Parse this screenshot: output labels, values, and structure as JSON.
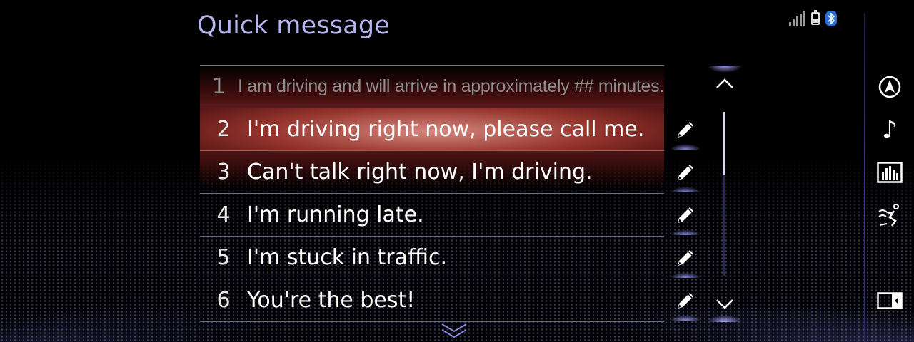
{
  "header": {
    "title": "Quick message"
  },
  "status": {
    "signal_icon": "signal-bars-icon",
    "battery_icon": "battery-icon",
    "bluetooth_icon": "bluetooth-icon",
    "bluetooth_color": "#2a6fd6"
  },
  "messages": [
    {
      "num": "1",
      "text": "I am driving and will arrive in approximately ## minutes."
    },
    {
      "num": "2",
      "text": "I'm driving right now, please call me."
    },
    {
      "num": "3",
      "text": "Can't talk right now, I'm driving."
    },
    {
      "num": "4",
      "text": "I'm running late."
    },
    {
      "num": "5",
      "text": "I'm stuck in traffic."
    },
    {
      "num": "6",
      "text": "You're the best!"
    }
  ],
  "selected_index": 2,
  "edit_icon": "pencil-icon",
  "scroll": {
    "up_icon": "chevron-up-icon",
    "down_icon": "chevron-down-icon",
    "more_icon": "double-chevron-down-icon"
  },
  "sidebar": {
    "items": [
      {
        "icon": "navigation-compass-icon"
      },
      {
        "icon": "music-note-icon",
        "glyph": "♪"
      },
      {
        "icon": "audio-equalizer-icon"
      },
      {
        "icon": "climate-seat-icon"
      },
      {
        "icon": "screen-split-icon"
      }
    ]
  },
  "colors": {
    "title": "#b6b5f0",
    "accent_line": "#6464c8",
    "highlight": "#e2736a",
    "background": "#000000"
  }
}
